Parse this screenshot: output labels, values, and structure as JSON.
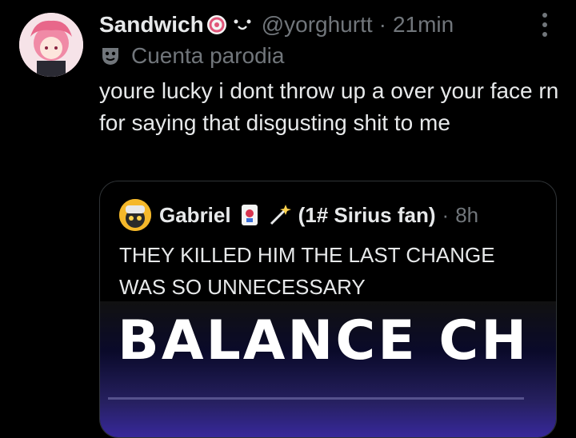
{
  "post": {
    "display_name": "Sandwich",
    "handle": "@yorghurtt",
    "separator": "·",
    "time": "21min",
    "parody_label": "Cuenta parodia",
    "text": "youre lucky i dont throw up a over your face rn for saying that disgusting shit to me"
  },
  "quote": {
    "display_name": "Gabriel",
    "fan_text": "(1# Sirius fan)",
    "separator": "·",
    "time": "8h",
    "text": "THEY KILLED HIM THE LAST CHANGE WAS SO UNNECESSARY",
    "media_title": "BALANCE CH"
  },
  "colors": {
    "background": "#000000",
    "text": "#e7e9ea",
    "muted": "#71767b",
    "border": "#2f3336"
  },
  "icons": {
    "more": "more-options-icon",
    "parody": "mask-icon",
    "badge": "swirl-badge-icon",
    "deco": "face-deco-icon",
    "card": "playing-card-icon",
    "wand": "magic-wand-icon"
  }
}
